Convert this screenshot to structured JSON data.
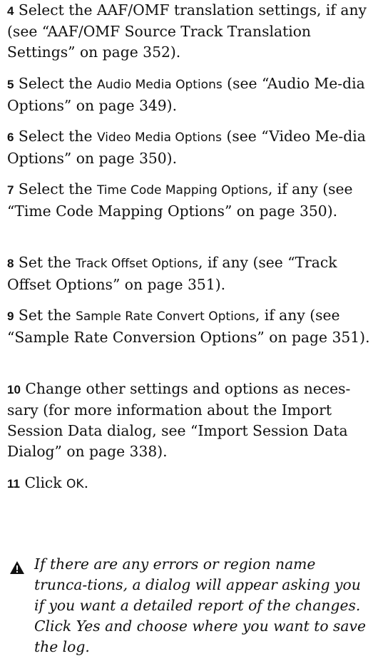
{
  "steps": [
    {
      "num": "4",
      "pre": "Select the AAF/OMF translation settings, if any (see “AAF/OMF Source Track Translation Settings” on page 352).",
      "ui": "",
      "post": ""
    },
    {
      "num": "5",
      "pre": "Select the ",
      "ui": "Audio Media Options",
      "post": " (see “Audio Me-dia Options” on page 349)."
    },
    {
      "num": "6",
      "pre": "Select the ",
      "ui": "Video Media Options",
      "post": " (see “Video Me-dia Options” on page 350)."
    },
    {
      "num": "7",
      "pre": "Select the ",
      "ui": "Time Code Mapping Options",
      "post": ", if any (see “Time Code Mapping Options” on page 350)."
    },
    {
      "num": "8",
      "pre": "Set the ",
      "ui": "Track Offset Options",
      "post": ", if any (see “Track Offset Options” on page 351)."
    },
    {
      "num": "9",
      "pre": "Set the ",
      "ui": "Sample Rate Convert Options",
      "post": ", if any (see “Sample Rate Conversion Options” on page 351)."
    },
    {
      "num": "10",
      "pre": "Change other settings and options as neces-sary (for more information about the Import Session Data dialog, see “Import Session Data Dialog” on page 338).",
      "ui": "",
      "post": ""
    },
    {
      "num": "11",
      "pre": "Click ",
      "ui": "OK",
      "post": "."
    }
  ],
  "note": {
    "icon": "warning-triangle-icon",
    "text": "If there are any errors or region name trunca-tions, a dialog will appear asking you if you want a detailed report of the changes. Click Yes and choose where you want to save the log."
  }
}
